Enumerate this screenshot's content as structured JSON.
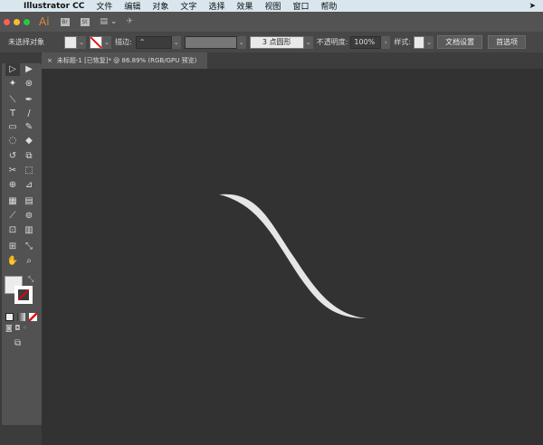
{
  "menubar": {
    "app": "Illustrator CC",
    "items": [
      "文件",
      "编辑",
      "对象",
      "文字",
      "选择",
      "效果",
      "视图",
      "窗口",
      "帮助"
    ]
  },
  "appbar": {
    "logo": "Ai",
    "bridge": "Br",
    "stock": "St"
  },
  "control": {
    "selection": "未选择对象",
    "stroke_label": "描边:",
    "brush": "3 点圆形",
    "opacity_label": "不透明度:",
    "opacity": "100%",
    "style_label": "样式:",
    "doc_setup": "文档设置",
    "prefs": "首选项"
  },
  "document": {
    "tab_title": "未标题-1 [已恢复]* @ 86.89% (RGB/GPU 预览)",
    "close": "×"
  },
  "tools": [
    "▷",
    "▶",
    "✦",
    "⊛",
    "⟍",
    "✒",
    "T",
    "/",
    "▭",
    "✎",
    "◌",
    "◆",
    "↺",
    "⧉",
    "✂",
    "⬚",
    "⊕",
    "⊿",
    "▦",
    "▤",
    "⟋",
    "⊚",
    "⊡",
    "▥",
    "⊞",
    "⤡",
    "✋",
    "⌕"
  ],
  "colors": {
    "canvas": "#323232",
    "shape": "#e6e6e6",
    "fill": "#ececec"
  }
}
